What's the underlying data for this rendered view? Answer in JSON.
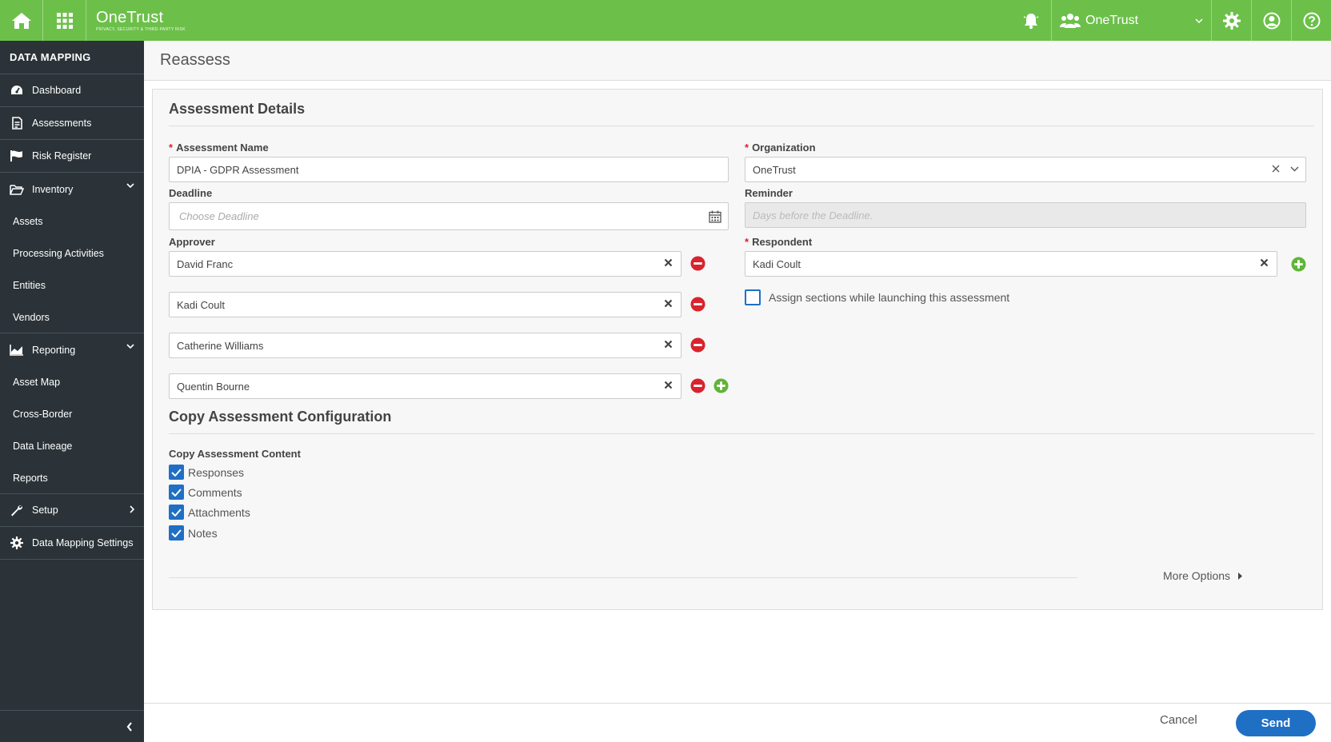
{
  "topbar": {
    "brand": "OneTrust",
    "tagline": "PRIVACY, SECURITY & THIRD-PARTY RISK",
    "org_name": "OneTrust",
    "colors": {
      "brand_green": "#6cc04a"
    },
    "icons": [
      "home-icon",
      "apps-grid-icon",
      "bell-icon",
      "users-icon",
      "chevron-down-icon",
      "gear-icon",
      "user-icon",
      "help-icon"
    ]
  },
  "sidebar": {
    "title": "DATA MAPPING",
    "items": [
      {
        "label": "Dashboard",
        "icon": "dashboard-icon"
      },
      {
        "label": "Assessments",
        "icon": "document-icon"
      },
      {
        "label": "Risk Register",
        "icon": "flag-icon"
      },
      {
        "label": "Inventory",
        "icon": "folder-icon",
        "expanded": true,
        "children": [
          "Assets",
          "Processing Activities",
          "Entities",
          "Vendors"
        ]
      },
      {
        "label": "Reporting",
        "icon": "chart-icon",
        "expanded": true,
        "children": [
          "Asset Map",
          "Cross-Border",
          "Data Lineage",
          "Reports"
        ]
      },
      {
        "label": "Setup",
        "icon": "wrench-icon",
        "expanded": false
      },
      {
        "label": "Data Mapping Settings",
        "icon": "gear-icon"
      }
    ],
    "colors": {
      "bg": "#2b3338"
    }
  },
  "page": {
    "title": "Reassess"
  },
  "details": {
    "section_title": "Assessment Details",
    "assessment_name": {
      "label": "Assessment Name",
      "value": "DPIA - GDPR Assessment"
    },
    "organization": {
      "label": "Organization",
      "value": "OneTrust"
    },
    "deadline": {
      "label": "Deadline",
      "placeholder": "Choose Deadline"
    },
    "reminder": {
      "label": "Reminder",
      "placeholder": "Days before the Deadline."
    },
    "approver": {
      "label": "Approver",
      "entries": [
        "David Franc",
        "Kadi Coult",
        "Catherine Williams",
        "Quentin Bourne"
      ]
    },
    "respondent": {
      "label": "Respondent",
      "value": "Kadi Coult"
    },
    "assign_sections": {
      "label": "Assign sections while launching this assessment",
      "checked": false
    }
  },
  "copy_config": {
    "section_title": "Copy Assessment Configuration",
    "content_label": "Copy Assessment Content",
    "options": [
      {
        "label": "Responses",
        "checked": true
      },
      {
        "label": "Comments",
        "checked": true
      },
      {
        "label": "Attachments",
        "checked": true
      },
      {
        "label": "Notes",
        "checked": true
      }
    ],
    "more_options": "More Options"
  },
  "footer": {
    "cancel": "Cancel",
    "send": "Send",
    "colors": {
      "primary": "#1f6fc5",
      "remove": "#d9232d",
      "add": "#5fb536"
    }
  }
}
